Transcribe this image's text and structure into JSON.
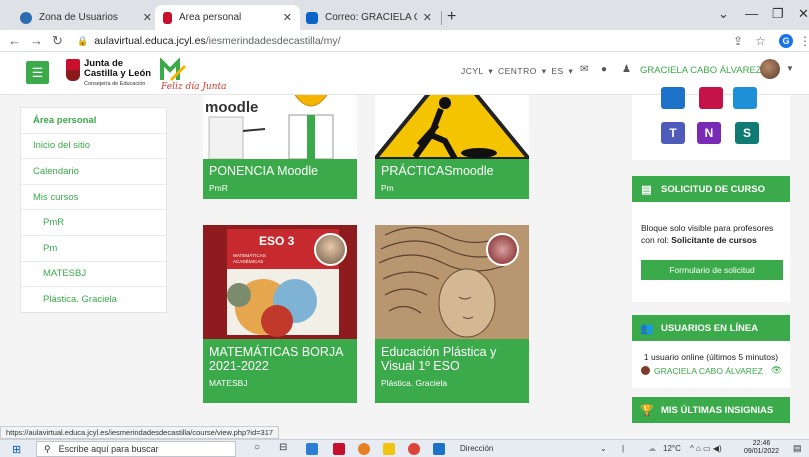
{
  "browser": {
    "tabs": [
      {
        "label": "Zona de Usuarios",
        "active": false,
        "icon": "globe-blue-icon"
      },
      {
        "label": "Área personal",
        "active": true,
        "icon": "jcyl-favicon-icon"
      },
      {
        "label": "Correo: GRACIELA CABO ÁLVARE",
        "active": false,
        "icon": "outlook-icon"
      }
    ],
    "url_host": "aulavirtual.educa.jcyl.es",
    "url_path": "/iesmerindadesdecastilla/my/",
    "profile_initial": "G"
  },
  "header": {
    "org_line1": "Junta de",
    "org_line2": "Castilla y León",
    "org_sub": "Consejería de Educación",
    "logo_text": "Feliz día Junta",
    "menu_items": "JCYL ▾  CENTRO ▾  ES ▾",
    "user_name": "GRACIELA CABO ÁLVAREZ"
  },
  "left_nav": {
    "items": [
      {
        "label": "Área personal",
        "bold": true,
        "sub": false
      },
      {
        "label": "Inicio del sitio",
        "bold": false,
        "sub": false
      },
      {
        "label": "Calendario",
        "bold": false,
        "sub": false
      },
      {
        "label": "Mis cursos",
        "bold": false,
        "sub": false
      },
      {
        "label": "PmR",
        "bold": false,
        "sub": true
      },
      {
        "label": "Pm",
        "bold": false,
        "sub": true
      },
      {
        "label": "MATESBJ",
        "bold": false,
        "sub": true
      },
      {
        "label": "Plástica. Graciela",
        "bold": false,
        "sub": true
      }
    ]
  },
  "courses": [
    {
      "title": "PONENCIA Moodle",
      "short": "PmR",
      "image_text": "moodle"
    },
    {
      "title": "PRÁCTICASmoodle",
      "short": "Pm"
    },
    {
      "title": "MATEMÁTICAS BORJA 2021-2022",
      "short": "MATESBJ",
      "book_number": "ESO 3",
      "book_title": "MATEMÁTICAS ORIENTADAS A LAS ENSEÑANZAS ACADÉMICAS"
    },
    {
      "title": "Educación Plástica y Visual 1º ESO",
      "short": "Plástica. Graciela"
    }
  ],
  "right": {
    "solicitud_title": "SOLICITUD DE CURSO",
    "solicitud_text": "Bloque solo visible para profesores con rol:",
    "solicitud_role": "Solicitante de cursos",
    "solicitud_button": "Formulario de solicitud",
    "online_title": "USUARIOS EN LÍNEA",
    "online_text": "1 usuario online (últimos 5 minutos)",
    "online_user": "GRACIELA CABO ÁLVAREZ",
    "badges_title": "MIS ÚLTIMAS INSIGNIAS"
  },
  "status_url": "https://aulavirtual.educa.jcyl.es/iesmerindadesdecastilla/course/view.php?id=317",
  "taskbar": {
    "search_placeholder": "Escribe aquí para buscar",
    "address_label": "Dirección",
    "temperature": "12°C",
    "time": "22:46",
    "date": "09/01/2022"
  },
  "colors": {
    "accent": "#3aaa4a",
    "tab_bar": "#dee1e6"
  }
}
